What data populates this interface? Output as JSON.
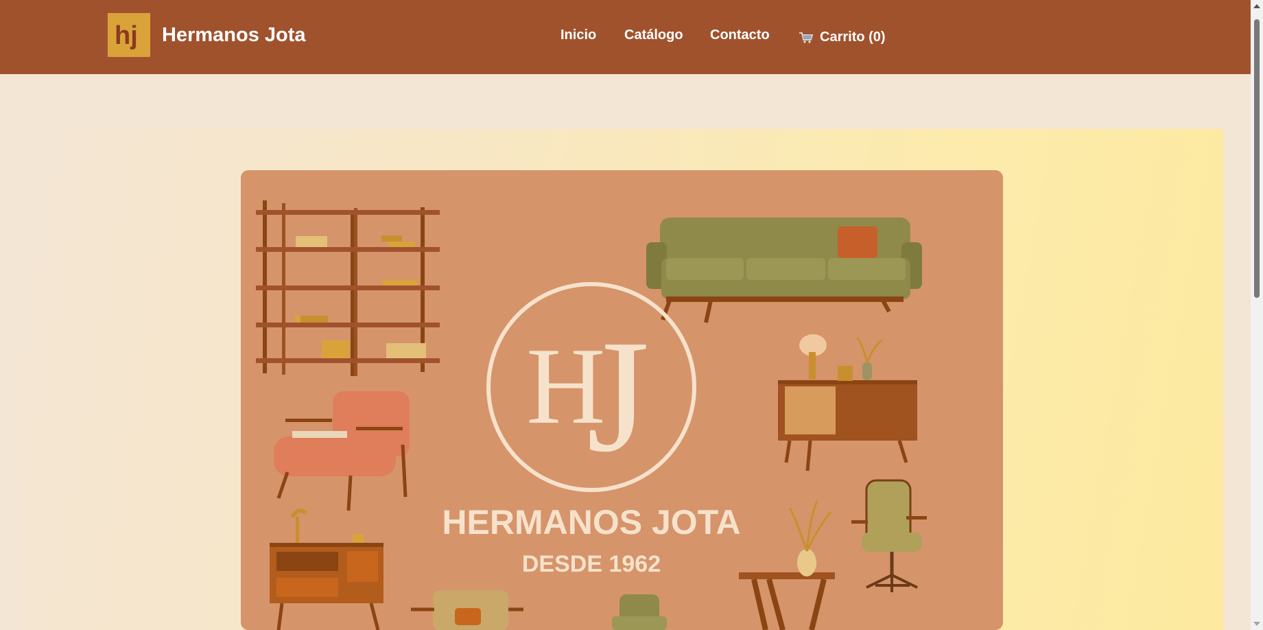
{
  "brand": {
    "name": "Hermanos Jota",
    "logo_text": "hj",
    "logo_icon": "hj-monogram-logo",
    "colors": {
      "navbar": "#a0522d",
      "logo": "#d9a33a"
    }
  },
  "nav": {
    "items": [
      {
        "label": "Inicio"
      },
      {
        "label": "Catálogo"
      },
      {
        "label": "Contacto"
      }
    ],
    "cart": {
      "icon": "cart-icon",
      "label": "Carrito (0)"
    }
  },
  "hero": {
    "monogram": {
      "h": "H",
      "j": "J"
    },
    "title": "HERMANOS JOTA",
    "subtitle": "DESDE 1962",
    "colors": {
      "card": "#d6946b",
      "accent": "#f6e2cb"
    }
  }
}
